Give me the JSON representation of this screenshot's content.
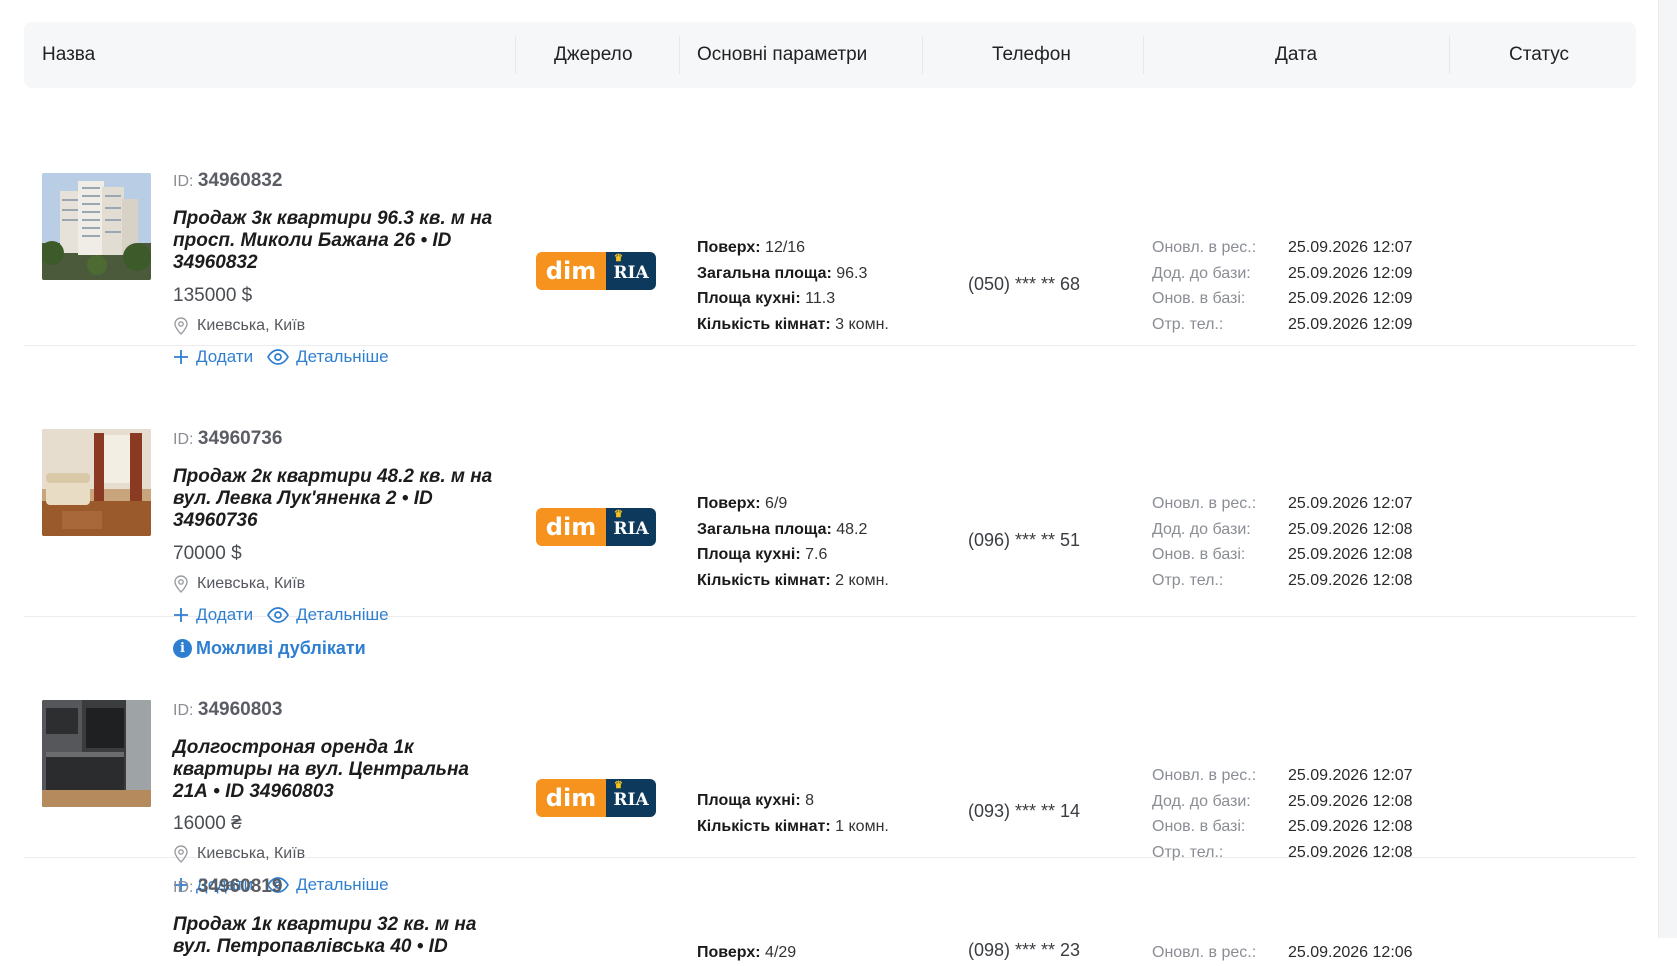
{
  "header": {
    "name": "Назва",
    "source": "Джерело",
    "params": "Основні параметри",
    "phone": "Телефон",
    "date": "Дата",
    "status": "Статус"
  },
  "labels": {
    "id_prefix": "ID:",
    "add": "Додати",
    "details": "Детальніше",
    "duplicates": "Можливі дублікати",
    "logo_left": "dim",
    "logo_right": "RIA",
    "date_updated_res": "Оновл. в рес.:",
    "date_added": "Дод. до бази:",
    "date_updated_db": "Онов. в базі:",
    "date_phone": "Отр. тел.:"
  },
  "listings": [
    {
      "id": "34960832",
      "title": "Продаж 3к квартири 96.3 кв. м на просп. Миколи Бажана 26 • ID 34960832",
      "price": "135000 $",
      "location": "Киевська, Київ",
      "params": [
        {
          "label": "Поверх:",
          "value": " 12/16"
        },
        {
          "label": "Загальна площа:",
          "value": " 96.3"
        },
        {
          "label": "Площа кухні:",
          "value": " 11.3"
        },
        {
          "label": "Кількість кімнат:",
          "value": " 3 комн."
        }
      ],
      "phone": "(050) *** ** 68",
      "dates": [
        "25.09.2026 12:07",
        "25.09.2026 12:09",
        "25.09.2026 12:09",
        "25.09.2026 12:09"
      ]
    },
    {
      "id": "34960736",
      "title": "Продаж 2к квартири 48.2 кв. м на вул. Левка Лук'яненка 2 • ID 34960736",
      "price": "70000 $",
      "location": "Киевська, Київ",
      "params": [
        {
          "label": "Поверх:",
          "value": " 6/9"
        },
        {
          "label": "Загальна площа:",
          "value": " 48.2"
        },
        {
          "label": "Площа кухні:",
          "value": " 7.6"
        },
        {
          "label": "Кількість кімнат:",
          "value": " 2 комн."
        }
      ],
      "phone": "(096) *** ** 51",
      "dates": [
        "25.09.2026 12:07",
        "25.09.2026 12:08",
        "25.09.2026 12:08",
        "25.09.2026 12:08"
      ]
    },
    {
      "id": "34960803",
      "title": "Долгострoная оренда 1к квартиры на вул. Центральна 21А • ID 34960803",
      "price": "16000 ₴",
      "location": "Киевська, Київ",
      "params": [
        {
          "label": "Площа кухні:",
          "value": " 8"
        },
        {
          "label": "Кількість кімнат:",
          "value": " 1 комн."
        }
      ],
      "phone": "(093) *** ** 14",
      "dates": [
        "25.09.2026 12:07",
        "25.09.2026 12:08",
        "25.09.2026 12:08",
        "25.09.2026 12:08"
      ]
    },
    {
      "id": "34960819",
      "title": "Продаж 1к квартири 32 кв. м на вул. Петропавлівська 40 • ID",
      "params": [
        {
          "label": "Поверх:",
          "value": " 4/29"
        }
      ],
      "phone": "(098) *** ** 23",
      "dates": [
        "25.09.2026 12:06"
      ]
    }
  ],
  "colors": {
    "link": "#2f7fd0",
    "logo_orange": "#f6921e",
    "logo_navy": "#0d3a5c",
    "header_bg": "#f6f7f8"
  }
}
